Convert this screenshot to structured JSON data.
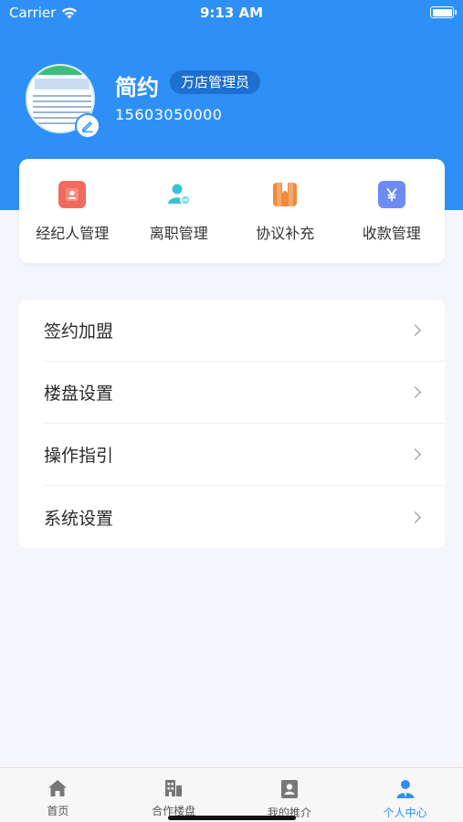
{
  "status_bar": {
    "carrier": "Carrier",
    "time": "9:13 AM"
  },
  "profile": {
    "name": "简约",
    "role": "万店管理员",
    "phone": "15603050000"
  },
  "quick_actions": [
    {
      "label": "经纪人管理",
      "icon": "agent-icon",
      "color": "#f06a5f"
    },
    {
      "label": "离职管理",
      "icon": "resign-icon",
      "color": "#37c2d6"
    },
    {
      "label": "协议补充",
      "icon": "agreement-icon",
      "color": "#f08a3c"
    },
    {
      "label": "收款管理",
      "icon": "payment-icon",
      "color": "#6c8cf2"
    }
  ],
  "menu": [
    {
      "label": "签约加盟"
    },
    {
      "label": "楼盘设置"
    },
    {
      "label": "操作指引"
    },
    {
      "label": "系统设置"
    }
  ],
  "tabs": [
    {
      "label": "首页",
      "icon": "home-icon"
    },
    {
      "label": "合作楼盘",
      "icon": "building-icon"
    },
    {
      "label": "我的推介",
      "icon": "contact-card-icon"
    },
    {
      "label": "个人中心",
      "icon": "person-icon",
      "active": true
    }
  ],
  "colors": {
    "brand": "#2e90f6",
    "background": "#f4f6fb"
  }
}
